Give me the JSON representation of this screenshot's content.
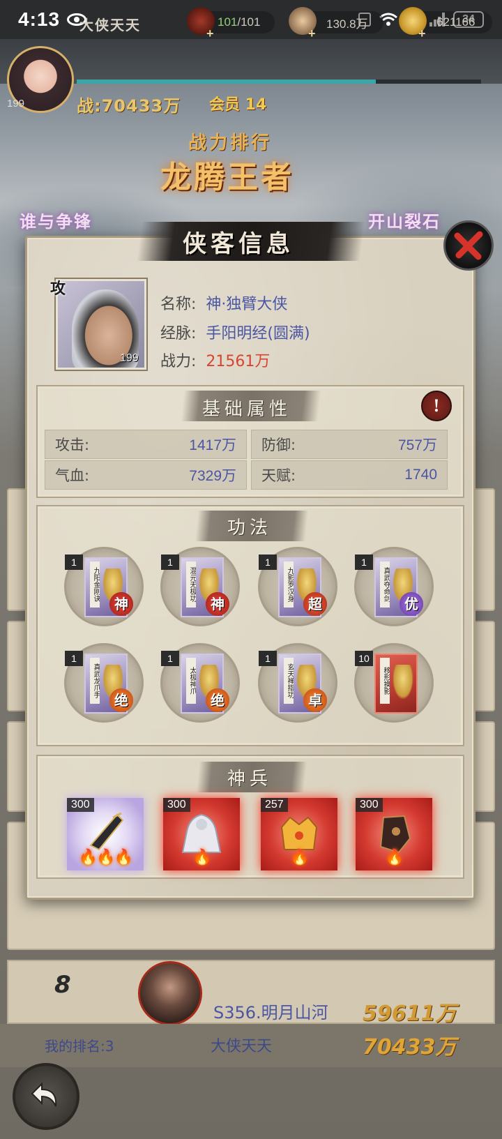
{
  "status_bar": {
    "time": "4:13",
    "battery": "34"
  },
  "player": {
    "name": "大侠天天",
    "level": "199",
    "power": "战:70433万",
    "vip": "会员 14"
  },
  "resources": [
    {
      "icon": "jar-icon",
      "value_green": "101",
      "value_rest": "/101"
    },
    {
      "icon": "coin-icon",
      "value_green": "",
      "value_rest": "130.8万"
    },
    {
      "icon": "gold-ingot-icon",
      "value_green": "",
      "value_rest": "621166"
    }
  ],
  "banner": {
    "small": "战力排行",
    "big": "龙腾王者",
    "left": "谁与争锋",
    "right": "开山裂石"
  },
  "panel": {
    "title": "侠客信息",
    "hero": {
      "tag": "攻",
      "level": "199",
      "name_label": "名称:",
      "name": "神·独臂大侠",
      "meridian_label": "经脉:",
      "meridian": "手阳明经(圆满)",
      "power_label": "战力:",
      "power": "21561万"
    },
    "basic": {
      "title": "基础属性",
      "stats": [
        {
          "key": "攻击:",
          "value": "1417万"
        },
        {
          "key": "防御:",
          "value": "757万"
        },
        {
          "key": "气血:",
          "value": "7329万"
        },
        {
          "key": "天赋:",
          "value": "1740"
        }
      ]
    },
    "skills": {
      "title": "功法",
      "items": [
        {
          "level": "1",
          "name": "九阳金刚诀",
          "grade": "神",
          "grade_class": "g-shen",
          "card": ""
        },
        {
          "level": "1",
          "name": "混元无极功",
          "grade": "神",
          "grade_class": "g-shen",
          "card": ""
        },
        {
          "level": "1",
          "name": "九影罗汉身",
          "grade": "超",
          "grade_class": "g-chao",
          "card": ""
        },
        {
          "level": "1",
          "name": "真武夺命剑",
          "grade": "优",
          "grade_class": "g-you",
          "card": ""
        },
        {
          "level": "1",
          "name": "真武龙爪手",
          "grade": "绝",
          "grade_class": "g-jue",
          "card": ""
        },
        {
          "level": "1",
          "name": "太极神爪",
          "grade": "绝",
          "grade_class": "g-jue",
          "card": ""
        },
        {
          "level": "1",
          "name": "玄天禅指功",
          "grade": "卓",
          "grade_class": "g-jue",
          "card": ""
        },
        {
          "level": "10",
          "name": "移形换影",
          "grade": "",
          "grade_class": "",
          "card": "red"
        }
      ]
    },
    "weapons": {
      "title": "神兵",
      "items": [
        {
          "level": "300",
          "flames": "🔥🔥🔥",
          "style": "purple",
          "icon": "sword-icon"
        },
        {
          "level": "300",
          "flames": "🔥",
          "style": "red",
          "icon": "white-robe-icon"
        },
        {
          "level": "257",
          "flames": "🔥",
          "style": "red",
          "icon": "golden-crown-icon"
        },
        {
          "level": "300",
          "flames": "🔥",
          "style": "red",
          "icon": "dark-gauntlet-icon"
        }
      ]
    }
  },
  "ranking": {
    "row_number": "8",
    "row_server": "S356.明月山河",
    "row_power": "59611万",
    "my_rank_label": "我的排名:3",
    "my_name": "大侠天天",
    "my_power": "70433万"
  }
}
